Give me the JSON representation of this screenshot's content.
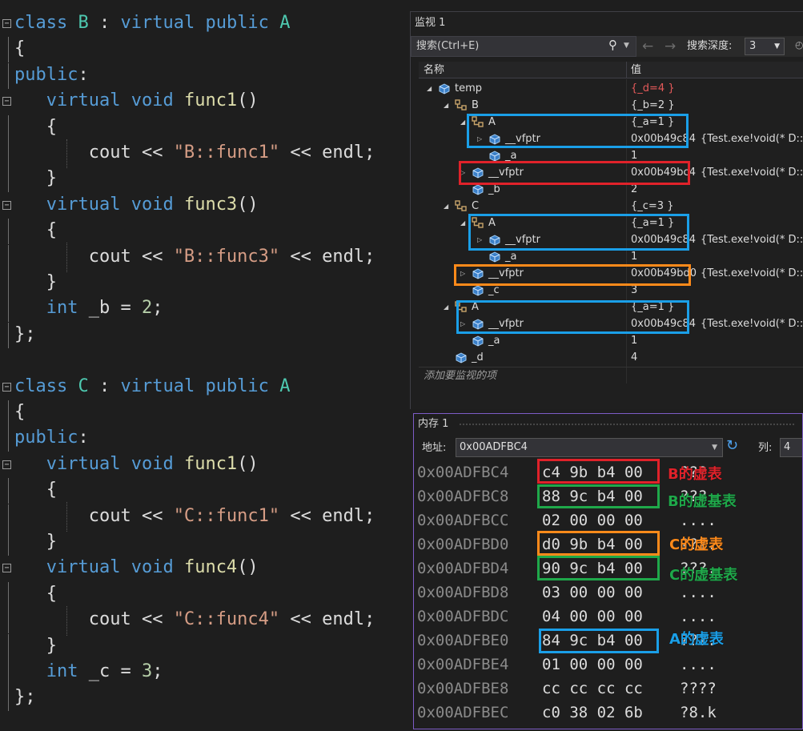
{
  "colors": {
    "red": "#e0222a",
    "blue": "#1a9fe8",
    "orange": "#ff8a1a",
    "green": "#1fa84a",
    "memory_border": "#7d5cc6"
  },
  "editor": {
    "lines": [
      {
        "fold": "⊟",
        "tokens": [
          [
            "kw",
            "class"
          ],
          [
            "pl",
            " "
          ],
          [
            "ty",
            "B"
          ],
          [
            "pl",
            " : "
          ],
          [
            "kw",
            "virtual"
          ],
          [
            "pl",
            " "
          ],
          [
            "kw",
            "public"
          ],
          [
            "pl",
            " "
          ],
          [
            "ty",
            "A"
          ]
        ]
      },
      {
        "tokens": [
          [
            "pl",
            "{"
          ]
        ]
      },
      {
        "tokens": [
          [
            "kw",
            "public"
          ],
          [
            "pl",
            ":"
          ]
        ]
      },
      {
        "fold": "⊟",
        "tokens": [
          [
            "pl",
            "   "
          ],
          [
            "kw",
            "virtual"
          ],
          [
            "pl",
            " "
          ],
          [
            "kw",
            "void"
          ],
          [
            "pl",
            " "
          ],
          [
            "fn",
            "func1"
          ],
          [
            "pl",
            "()"
          ]
        ]
      },
      {
        "tokens": [
          [
            "pl",
            "   {"
          ]
        ]
      },
      {
        "tokens": [
          [
            "pl",
            "       "
          ],
          [
            "id",
            "cout"
          ],
          [
            "pl",
            " << "
          ],
          [
            "str",
            "\"B::func1\""
          ],
          [
            "pl",
            " << "
          ],
          [
            "id",
            "endl"
          ],
          [
            "pl",
            ";"
          ]
        ]
      },
      {
        "tokens": [
          [
            "pl",
            "   }"
          ]
        ]
      },
      {
        "fold": "⊟",
        "tokens": [
          [
            "pl",
            "   "
          ],
          [
            "kw",
            "virtual"
          ],
          [
            "pl",
            " "
          ],
          [
            "kw",
            "void"
          ],
          [
            "pl",
            " "
          ],
          [
            "fn",
            "func3"
          ],
          [
            "pl",
            "()"
          ]
        ]
      },
      {
        "tokens": [
          [
            "pl",
            "   {"
          ]
        ]
      },
      {
        "tokens": [
          [
            "pl",
            "       "
          ],
          [
            "id",
            "cout"
          ],
          [
            "pl",
            " << "
          ],
          [
            "str",
            "\"B::func3\""
          ],
          [
            "pl",
            " << "
          ],
          [
            "id",
            "endl"
          ],
          [
            "pl",
            ";"
          ]
        ]
      },
      {
        "tokens": [
          [
            "pl",
            "   }"
          ]
        ]
      },
      {
        "tokens": [
          [
            "pl",
            "   "
          ],
          [
            "kw",
            "int"
          ],
          [
            "pl",
            " "
          ],
          [
            "id",
            "_b"
          ],
          [
            "pl",
            " = "
          ],
          [
            "num",
            "2"
          ],
          [
            "pl",
            ";"
          ]
        ]
      },
      {
        "tokens": [
          [
            "pl",
            "};"
          ]
        ]
      },
      {
        "tokens": []
      },
      {
        "fold": "⊟",
        "tokens": [
          [
            "kw",
            "class"
          ],
          [
            "pl",
            " "
          ],
          [
            "ty",
            "C"
          ],
          [
            "pl",
            " : "
          ],
          [
            "kw",
            "virtual"
          ],
          [
            "pl",
            " "
          ],
          [
            "kw",
            "public"
          ],
          [
            "pl",
            " "
          ],
          [
            "ty",
            "A"
          ]
        ]
      },
      {
        "tokens": [
          [
            "pl",
            "{"
          ]
        ]
      },
      {
        "tokens": [
          [
            "kw",
            "public"
          ],
          [
            "pl",
            ":"
          ]
        ]
      },
      {
        "fold": "⊟",
        "tokens": [
          [
            "pl",
            "   "
          ],
          [
            "kw",
            "virtual"
          ],
          [
            "pl",
            " "
          ],
          [
            "kw",
            "void"
          ],
          [
            "pl",
            " "
          ],
          [
            "fn",
            "func1"
          ],
          [
            "pl",
            "()"
          ]
        ]
      },
      {
        "tokens": [
          [
            "pl",
            "   {"
          ]
        ]
      },
      {
        "tokens": [
          [
            "pl",
            "       "
          ],
          [
            "id",
            "cout"
          ],
          [
            "pl",
            " << "
          ],
          [
            "str",
            "\"C::func1\""
          ],
          [
            "pl",
            " << "
          ],
          [
            "id",
            "endl"
          ],
          [
            "pl",
            ";"
          ]
        ]
      },
      {
        "tokens": [
          [
            "pl",
            "   }"
          ]
        ]
      },
      {
        "fold": "⊟",
        "tokens": [
          [
            "pl",
            "   "
          ],
          [
            "kw",
            "virtual"
          ],
          [
            "pl",
            " "
          ],
          [
            "kw",
            "void"
          ],
          [
            "pl",
            " "
          ],
          [
            "fn",
            "func4"
          ],
          [
            "pl",
            "()"
          ]
        ]
      },
      {
        "tokens": [
          [
            "pl",
            "   {"
          ]
        ]
      },
      {
        "tokens": [
          [
            "pl",
            "       "
          ],
          [
            "id",
            "cout"
          ],
          [
            "pl",
            " << "
          ],
          [
            "str",
            "\"C::func4\""
          ],
          [
            "pl",
            " << "
          ],
          [
            "id",
            "endl"
          ],
          [
            "pl",
            ";"
          ]
        ]
      },
      {
        "tokens": [
          [
            "pl",
            "   }"
          ]
        ]
      },
      {
        "tokens": [
          [
            "pl",
            "   "
          ],
          [
            "kw",
            "int"
          ],
          [
            "pl",
            " "
          ],
          [
            "id",
            "_c"
          ],
          [
            "pl",
            " = "
          ],
          [
            "num",
            "3"
          ],
          [
            "pl",
            ";"
          ]
        ]
      },
      {
        "tokens": [
          [
            "pl",
            "};"
          ]
        ]
      }
    ]
  },
  "watch": {
    "title": "监视 1",
    "search_placeholder": "搜索(Ctrl+E)",
    "search_icon": "search-icon",
    "depth_label": "搜索深度:",
    "depth_value": "3",
    "col_name": "名称",
    "col_value": "值",
    "add_item": "添加要监视的项",
    "rows": [
      {
        "expander": "open",
        "icon": "watch-object-icon",
        "name": "temp",
        "value": "{_d=4 }",
        "value_red": true
      },
      {
        "expander": "open",
        "icon": "base-class-icon",
        "name": "B",
        "value": "{_b=2 }"
      },
      {
        "expander": "open",
        "icon": "base-class-icon",
        "name": "A",
        "value": "{_a=1 }"
      },
      {
        "expander": "closed",
        "icon": "field-icon",
        "name": "__vfptr",
        "value": "0x00b49c84",
        "extra": "{Test.exe!void(* D::`vft"
      },
      {
        "expander": "none",
        "icon": "field-icon",
        "name": "_a",
        "value": "1"
      },
      {
        "expander": "closed",
        "icon": "field-icon",
        "name": "__vfptr",
        "value": "0x00b49bc4",
        "extra": "{Test.exe!void(* D::`vft"
      },
      {
        "expander": "none",
        "icon": "field-icon",
        "name": "_b",
        "value": "2"
      },
      {
        "expander": "open",
        "icon": "base-class-icon",
        "name": "C",
        "value": "{_c=3 }"
      },
      {
        "expander": "open",
        "icon": "base-class-icon",
        "name": "A",
        "value": "{_a=1 }"
      },
      {
        "expander": "closed",
        "icon": "field-icon",
        "name": "__vfptr",
        "value": "0x00b49c84",
        "extra": "{Test.exe!void(* D::`vft"
      },
      {
        "expander": "none",
        "icon": "field-icon",
        "name": "_a",
        "value": "1"
      },
      {
        "expander": "closed",
        "icon": "field-icon",
        "name": "__vfptr",
        "value": "0x00b49bd0",
        "extra": "{Test.exe!void(* D::`vft"
      },
      {
        "expander": "none",
        "icon": "field-icon",
        "name": "_c",
        "value": "3"
      },
      {
        "expander": "open",
        "icon": "base-class-icon",
        "name": "A",
        "value": "{_a=1 }"
      },
      {
        "expander": "closed",
        "icon": "field-icon",
        "name": "__vfptr",
        "value": "0x00b49c84",
        "extra": "{Test.exe!void(* D::`vft"
      },
      {
        "expander": "none",
        "icon": "field-icon",
        "name": "_a",
        "value": "1"
      },
      {
        "expander": "none",
        "icon": "field-icon",
        "name": "_d",
        "value": "4"
      }
    ]
  },
  "memory": {
    "title": "内存 1",
    "address_label": "地址:",
    "address_value": "0x00ADFBC4",
    "column_label": "列:",
    "column_value": "4",
    "rows": [
      {
        "addr": "0x00ADFBC4",
        "bytes": "c4 9b b4 00",
        "chars": "???."
      },
      {
        "addr": "0x00ADFBC8",
        "bytes": "88 9c b4 00",
        "chars": "???."
      },
      {
        "addr": "0x00ADFBCC",
        "bytes": "02 00 00 00",
        "chars": "...."
      },
      {
        "addr": "0x00ADFBD0",
        "bytes": "d0 9b b4 00",
        "chars": "???."
      },
      {
        "addr": "0x00ADFBD4",
        "bytes": "90 9c b4 00",
        "chars": "???."
      },
      {
        "addr": "0x00ADFBD8",
        "bytes": "03 00 00 00",
        "chars": "...."
      },
      {
        "addr": "0x00ADFBDC",
        "bytes": "04 00 00 00",
        "chars": "...."
      },
      {
        "addr": "0x00ADFBE0",
        "bytes": "84 9c b4 00",
        "chars": "???."
      },
      {
        "addr": "0x00ADFBE4",
        "bytes": "01 00 00 00",
        "chars": "...."
      },
      {
        "addr": "0x00ADFBE8",
        "bytes": "cc cc cc cc",
        "chars": "????"
      },
      {
        "addr": "0x00ADFBEC",
        "bytes": "c0 38 02 6b",
        "chars": "?8.k"
      }
    ]
  },
  "annotations": {
    "b_vtable": "B的虚表",
    "b_vbtable": "B的虚基表",
    "c_vtable": "C的虚表",
    "c_vbtable": "C的虚基表",
    "a_vtable": "A的虚表"
  }
}
